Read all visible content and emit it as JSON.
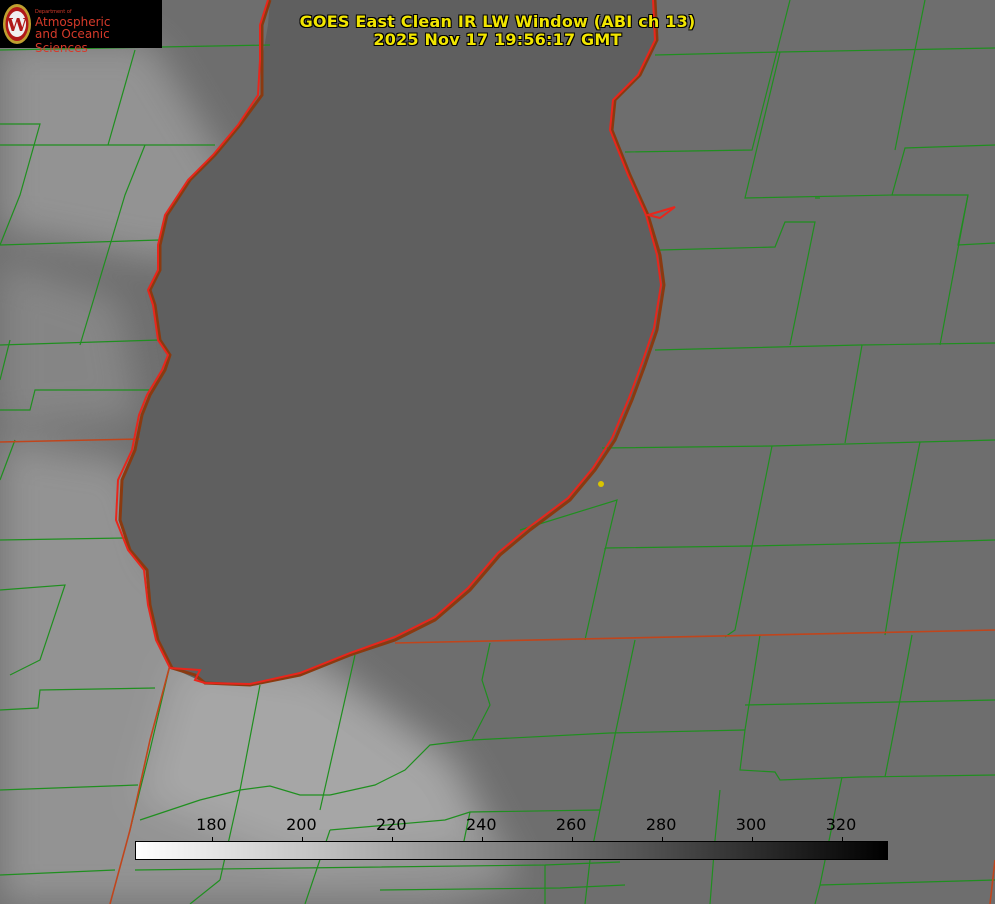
{
  "logo": {
    "line_department": "Department of",
    "line1": "Atmospheric",
    "line2": "and Oceanic Sciences",
    "seal_letter": "W"
  },
  "title": {
    "line1": "GOES East Clean IR LW Window (ABI ch 13)",
    "line2": "2025 Nov 17 19:56:17 GMT"
  },
  "colorbar": {
    "min": 163,
    "max": 330,
    "ticks": [
      180,
      200,
      220,
      240,
      260,
      280,
      300,
      320
    ],
    "gradient": [
      "#ffffff",
      "#000000"
    ]
  },
  "colors": {
    "background": "#6e6e6e",
    "county_lines": "#1f8f1f",
    "shoreline": "#e8261c",
    "state_line": "#c0451c",
    "title_text": "#f2e600",
    "marker": "#d9c400"
  }
}
